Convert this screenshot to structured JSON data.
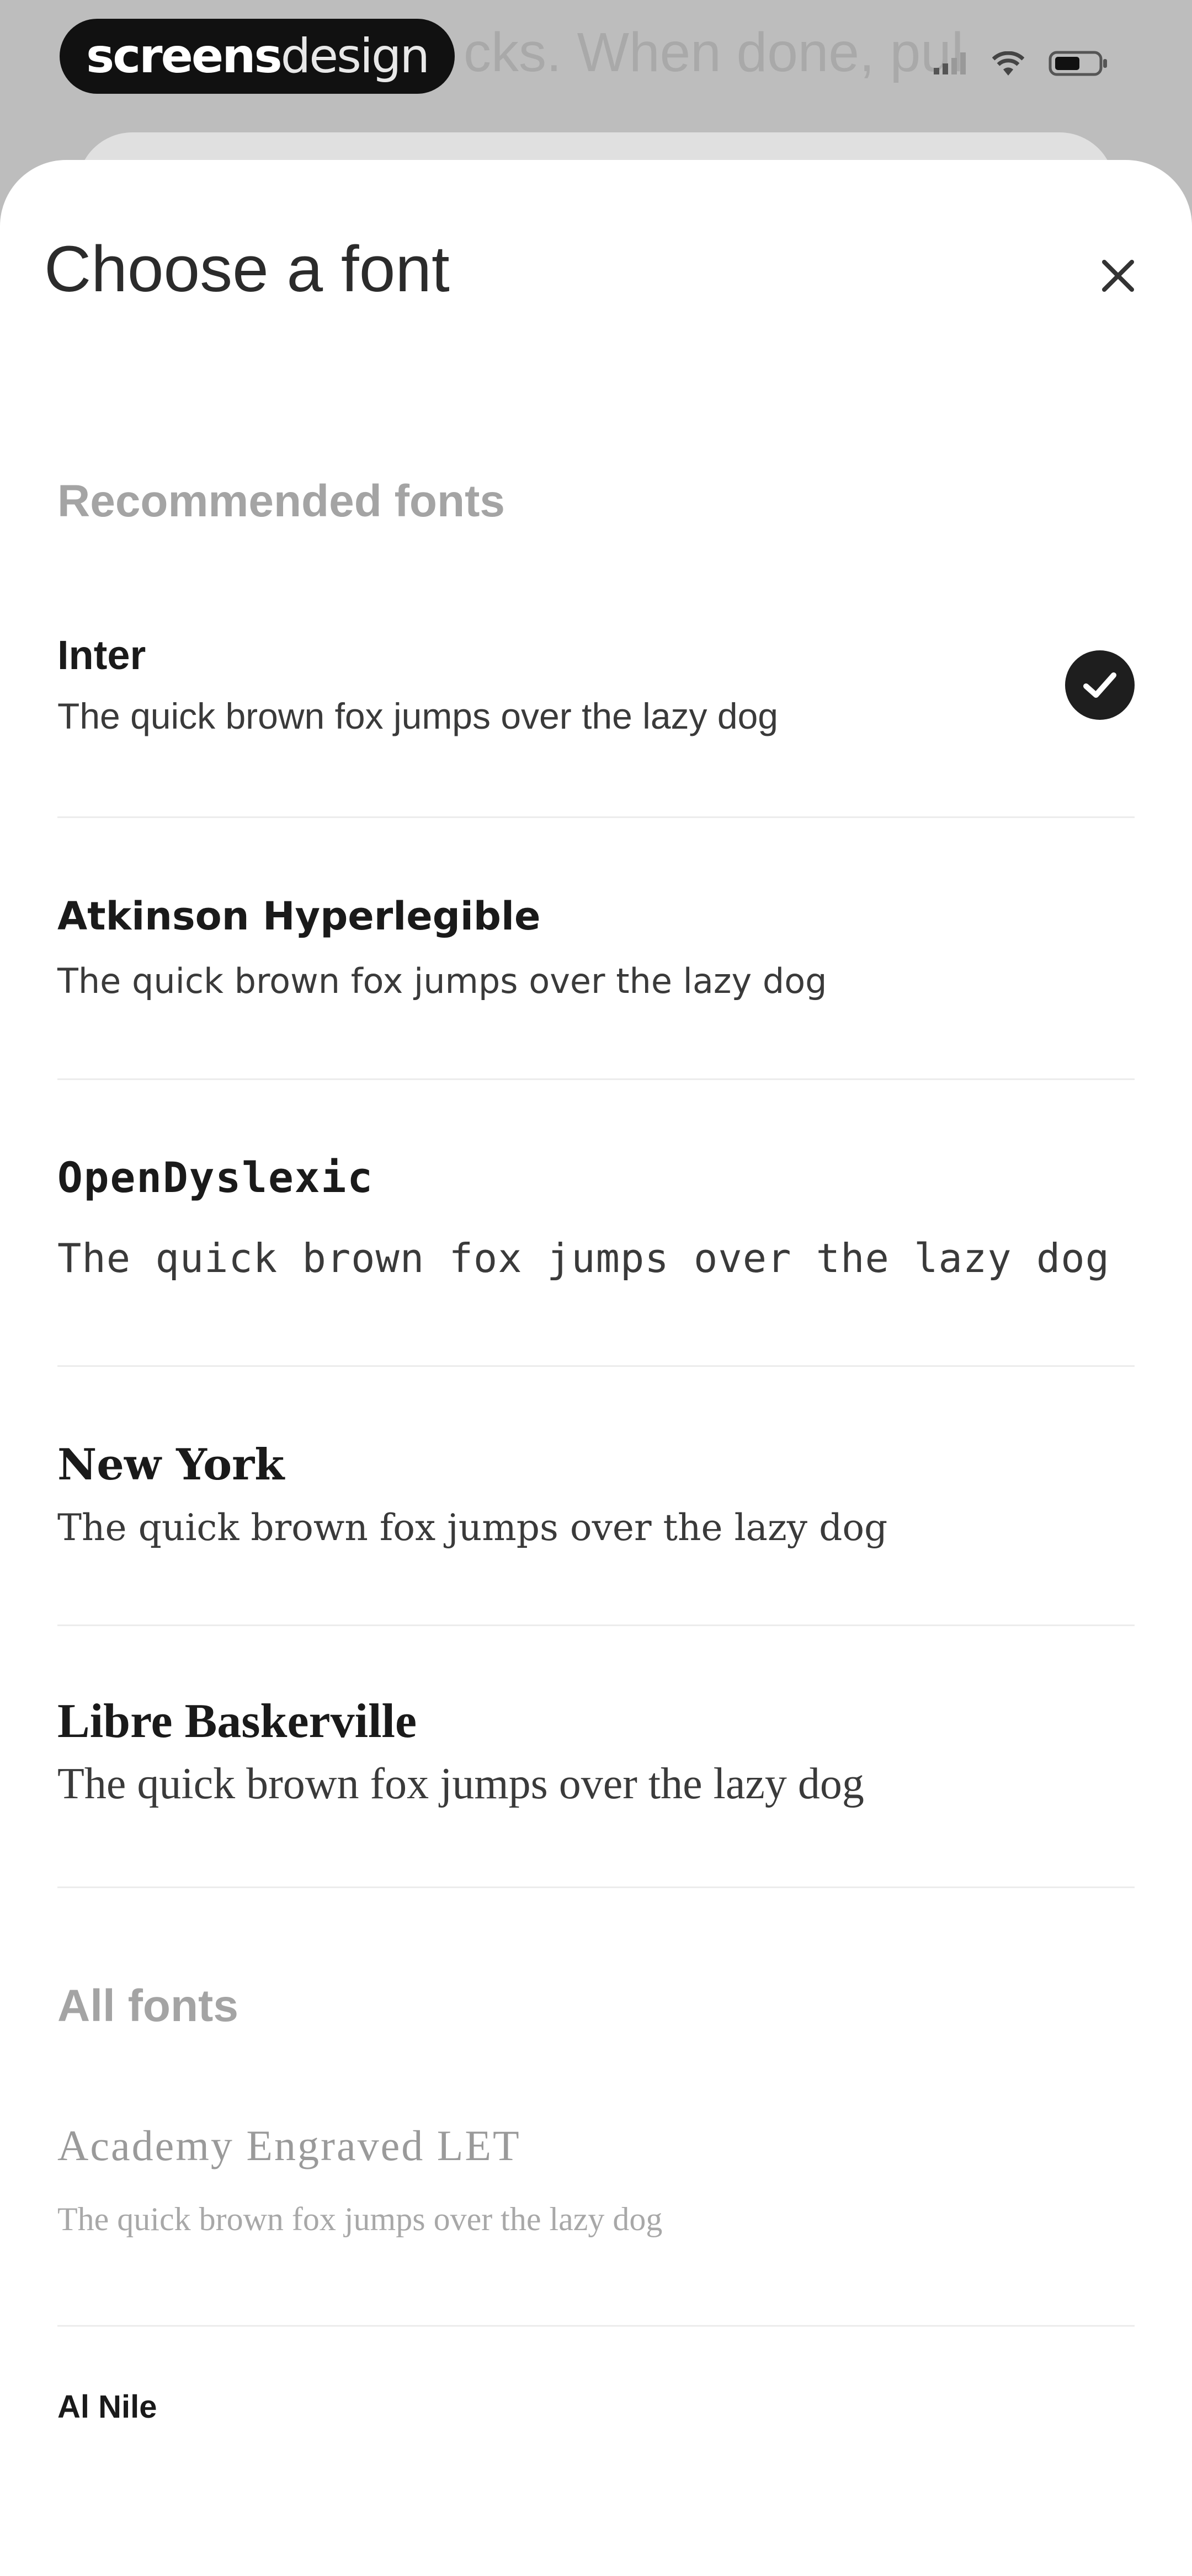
{
  "status_bar": {
    "brand_bold": "screens",
    "brand_light": "design",
    "background_caption": "cks. When done, pul"
  },
  "sheet": {
    "title": "Choose a font",
    "close_icon": "close-icon"
  },
  "sections": {
    "recommended": "Recommended fonts",
    "all": "All fonts"
  },
  "recommended_fonts": [
    {
      "name": "Inter",
      "sample": "The quick brown fox jumps over the lazy dog",
      "selected": true
    },
    {
      "name": "Atkinson Hyperlegible",
      "sample": "The quick brown fox jumps over the lazy dog",
      "selected": false
    },
    {
      "name": "OpenDyslexic",
      "sample": "The quick brown fox jumps over the lazy dog",
      "selected": false
    },
    {
      "name": "New York",
      "sample": "The quick brown fox jumps over the lazy dog",
      "selected": false
    },
    {
      "name": "Libre Baskerville",
      "sample": "The quick brown fox jumps over the lazy dog",
      "selected": false
    }
  ],
  "all_fonts": [
    {
      "name": "Academy Engraved LET",
      "sample": "The quick brown fox jumps over the lazy dog"
    },
    {
      "name": "Al Nile"
    }
  ],
  "colors": {
    "sheet_background": "#ffffff",
    "page_background": "#bdbdbd",
    "selected_badge": "#1e1e1e",
    "section_heading": "#a4a4a4"
  }
}
